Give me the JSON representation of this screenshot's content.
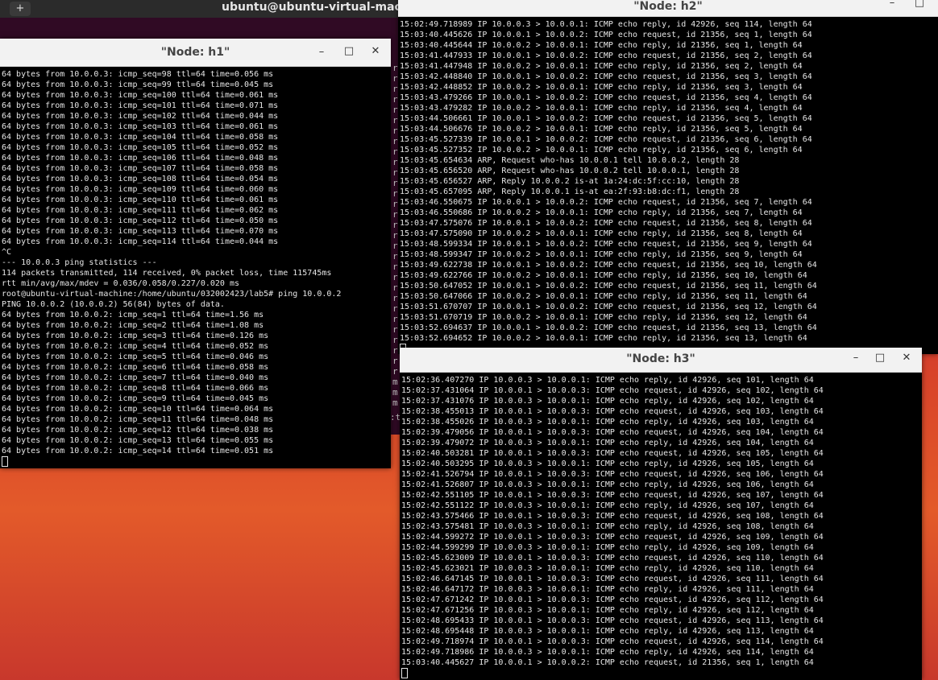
{
  "background_terminal": {
    "title": "ubuntu@ubuntu-virtual-machine",
    "new_tab_icon": "+",
    "side_chars": [
      "r",
      "r",
      "r",
      "r",
      "r",
      "r",
      "r",
      "r",
      "r",
      "r",
      "r",
      "r",
      "r",
      "r",
      "r",
      "r",
      "r",
      "r",
      "r",
      "r",
      "r",
      "r",
      "r",
      "r",
      "r",
      "r",
      "r",
      "r",
      "r",
      "r",
      "m",
      "m",
      "m"
    ],
    "colon": ":t"
  },
  "windows": {
    "h1": {
      "title": "\"Node: h1\"",
      "controls": {
        "minimize": "–",
        "maximize": "□",
        "close": "✕"
      },
      "lines": [
        "64 bytes from 10.0.0.3: icmp_seq=98 ttl=64 time=0.056 ms",
        "64 bytes from 10.0.0.3: icmp_seq=99 ttl=64 time=0.045 ms",
        "64 bytes from 10.0.0.3: icmp_seq=100 ttl=64 time=0.061 ms",
        "64 bytes from 10.0.0.3: icmp_seq=101 ttl=64 time=0.071 ms",
        "64 bytes from 10.0.0.3: icmp_seq=102 ttl=64 time=0.044 ms",
        "64 bytes from 10.0.0.3: icmp_seq=103 ttl=64 time=0.061 ms",
        "64 bytes from 10.0.0.3: icmp_seq=104 ttl=64 time=0.058 ms",
        "64 bytes from 10.0.0.3: icmp_seq=105 ttl=64 time=0.052 ms",
        "64 bytes from 10.0.0.3: icmp_seq=106 ttl=64 time=0.048 ms",
        "64 bytes from 10.0.0.3: icmp_seq=107 ttl=64 time=0.058 ms",
        "64 bytes from 10.0.0.3: icmp_seq=108 ttl=64 time=0.054 ms",
        "64 bytes from 10.0.0.3: icmp_seq=109 ttl=64 time=0.060 ms",
        "64 bytes from 10.0.0.3: icmp_seq=110 ttl=64 time=0.061 ms",
        "64 bytes from 10.0.0.3: icmp_seq=111 ttl=64 time=0.062 ms",
        "64 bytes from 10.0.0.3: icmp_seq=112 ttl=64 time=0.050 ms",
        "64 bytes from 10.0.0.3: icmp_seq=113 ttl=64 time=0.070 ms",
        "64 bytes from 10.0.0.3: icmp_seq=114 ttl=64 time=0.044 ms",
        "^C",
        "--- 10.0.0.3 ping statistics ---",
        "114 packets transmitted, 114 received, 0% packet loss, time 115745ms",
        "rtt min/avg/max/mdev = 0.036/0.058/0.227/0.020 ms",
        "root@ubuntu-virtual-machine:/home/ubuntu/032002423/lab5# ping 10.0.0.2",
        "PING 10.0.0.2 (10.0.0.2) 56(84) bytes of data.",
        "64 bytes from 10.0.0.2: icmp_seq=1 ttl=64 time=1.56 ms",
        "64 bytes from 10.0.0.2: icmp_seq=2 ttl=64 time=1.08 ms",
        "64 bytes from 10.0.0.2: icmp_seq=3 ttl=64 time=0.126 ms",
        "64 bytes from 10.0.0.2: icmp_seq=4 ttl=64 time=0.052 ms",
        "64 bytes from 10.0.0.2: icmp_seq=5 ttl=64 time=0.046 ms",
        "64 bytes from 10.0.0.2: icmp_seq=6 ttl=64 time=0.058 ms",
        "64 bytes from 10.0.0.2: icmp_seq=7 ttl=64 time=0.040 ms",
        "64 bytes from 10.0.0.2: icmp_seq=8 ttl=64 time=0.066 ms",
        "64 bytes from 10.0.0.2: icmp_seq=9 ttl=64 time=0.045 ms",
        "64 bytes from 10.0.0.2: icmp_seq=10 ttl=64 time=0.064 ms",
        "64 bytes from 10.0.0.2: icmp_seq=11 ttl=64 time=0.048 ms",
        "64 bytes from 10.0.0.2: icmp_seq=12 ttl=64 time=0.038 ms",
        "64 bytes from 10.0.0.2: icmp_seq=13 ttl=64 time=0.055 ms",
        "64 bytes from 10.0.0.2: icmp_seq=14 ttl=64 time=0.051 ms"
      ]
    },
    "h2": {
      "title": "\"Node: h2\"",
      "controls": {
        "minimize": "–",
        "maximize": "□"
      },
      "lines": [
        "15:02:49.718989 IP 10.0.0.3 > 10.0.0.1: ICMP echo reply, id 42926, seq 114, length 64",
        "15:03:40.445626 IP 10.0.0.1 > 10.0.0.2: ICMP echo request, id 21356, seq 1, length 64",
        "15:03:40.445644 IP 10.0.0.2 > 10.0.0.1: ICMP echo reply, id 21356, seq 1, length 64",
        "15:03:41.447933 IP 10.0.0.1 > 10.0.0.2: ICMP echo request, id 21356, seq 2, length 64",
        "15:03:41.447948 IP 10.0.0.2 > 10.0.0.1: ICMP echo reply, id 21356, seq 2, length 64",
        "15:03:42.448840 IP 10.0.0.1 > 10.0.0.2: ICMP echo request, id 21356, seq 3, length 64",
        "15:03:42.448852 IP 10.0.0.2 > 10.0.0.1: ICMP echo reply, id 21356, seq 3, length 64",
        "15:03:43.479266 IP 10.0.0.1 > 10.0.0.2: ICMP echo request, id 21356, seq 4, length 64",
        "15:03:43.479282 IP 10.0.0.2 > 10.0.0.1: ICMP echo reply, id 21356, seq 4, length 64",
        "15:03:44.506661 IP 10.0.0.1 > 10.0.0.2: ICMP echo request, id 21356, seq 5, length 64",
        "15:03:44.506676 IP 10.0.0.2 > 10.0.0.1: ICMP echo reply, id 21356, seq 5, length 64",
        "15:03:45.527339 IP 10.0.0.1 > 10.0.0.2: ICMP echo request, id 21356, seq 6, length 64",
        "15:03:45.527352 IP 10.0.0.2 > 10.0.0.1: ICMP echo reply, id 21356, seq 6, length 64",
        "15:03:45.654634 ARP, Request who-has 10.0.0.1 tell 10.0.0.2, length 28",
        "15:03:45.656520 ARP, Request who-has 10.0.0.2 tell 10.0.0.1, length 28",
        "15:03:45.656527 ARP, Reply 10.0.0.2 is-at 1a:24:dc:5f:cc:10, length 28",
        "15:03:45.657095 ARP, Reply 10.0.0.1 is-at ea:2f:93:b8:dc:f1, length 28",
        "15:03:46.550675 IP 10.0.0.1 > 10.0.0.2: ICMP echo request, id 21356, seq 7, length 64",
        "15:03:46.550686 IP 10.0.0.2 > 10.0.0.1: ICMP echo reply, id 21356, seq 7, length 64",
        "15:03:47.575076 IP 10.0.0.1 > 10.0.0.2: ICMP echo request, id 21356, seq 8, length 64",
        "15:03:47.575090 IP 10.0.0.2 > 10.0.0.1: ICMP echo reply, id 21356, seq 8, length 64",
        "15:03:48.599334 IP 10.0.0.1 > 10.0.0.2: ICMP echo request, id 21356, seq 9, length 64",
        "15:03:48.599347 IP 10.0.0.2 > 10.0.0.1: ICMP echo reply, id 21356, seq 9, length 64",
        "15:03:49.622738 IP 10.0.0.1 > 10.0.0.2: ICMP echo request, id 21356, seq 10, length 64",
        "15:03:49.622766 IP 10.0.0.2 > 10.0.0.1: ICMP echo reply, id 21356, seq 10, length 64",
        "15:03:50.647052 IP 10.0.0.1 > 10.0.0.2: ICMP echo request, id 21356, seq 11, length 64",
        "15:03:50.647066 IP 10.0.0.2 > 10.0.0.1: ICMP echo reply, id 21356, seq 11, length 64",
        "15:03:51.670707 IP 10.0.0.1 > 10.0.0.2: ICMP echo request, id 21356, seq 12, length 64",
        "15:03:51.670719 IP 10.0.0.2 > 10.0.0.1: ICMP echo reply, id 21356, seq 12, length 64",
        "15:03:52.694637 IP 10.0.0.1 > 10.0.0.2: ICMP echo request, id 21356, seq 13, length 64",
        "15:03:52.694652 IP 10.0.0.2 > 10.0.0.1: ICMP echo reply, id 21356, seq 13, length 64"
      ]
    },
    "h3": {
      "title": "\"Node: h3\"",
      "controls": {
        "minimize": "–",
        "maximize": "□",
        "close": "✕"
      },
      "lines": [
        "15:02:36.407270 IP 10.0.0.3 > 10.0.0.1: ICMP echo reply, id 42926, seq 101, length 64",
        "15:02:37.431064 IP 10.0.0.1 > 10.0.0.3: ICMP echo request, id 42926, seq 102, length 64",
        "15:02:37.431076 IP 10.0.0.3 > 10.0.0.1: ICMP echo reply, id 42926, seq 102, length 64",
        "15:02:38.455013 IP 10.0.0.1 > 10.0.0.3: ICMP echo request, id 42926, seq 103, length 64",
        "15:02:38.455026 IP 10.0.0.3 > 10.0.0.1: ICMP echo reply, id 42926, seq 103, length 64",
        "15:02:39.479056 IP 10.0.0.1 > 10.0.0.3: ICMP echo request, id 42926, seq 104, length 64",
        "15:02:39.479072 IP 10.0.0.3 > 10.0.0.1: ICMP echo reply, id 42926, seq 104, length 64",
        "15:02:40.503281 IP 10.0.0.1 > 10.0.0.3: ICMP echo request, id 42926, seq 105, length 64",
        "15:02:40.503295 IP 10.0.0.3 > 10.0.0.1: ICMP echo reply, id 42926, seq 105, length 64",
        "15:02:41.526794 IP 10.0.0.1 > 10.0.0.3: ICMP echo request, id 42926, seq 106, length 64",
        "15:02:41.526807 IP 10.0.0.3 > 10.0.0.1: ICMP echo reply, id 42926, seq 106, length 64",
        "15:02:42.551105 IP 10.0.0.1 > 10.0.0.3: ICMP echo request, id 42926, seq 107, length 64",
        "15:02:42.551122 IP 10.0.0.3 > 10.0.0.1: ICMP echo reply, id 42926, seq 107, length 64",
        "15:02:43.575466 IP 10.0.0.1 > 10.0.0.3: ICMP echo request, id 42926, seq 108, length 64",
        "15:02:43.575481 IP 10.0.0.3 > 10.0.0.1: ICMP echo reply, id 42926, seq 108, length 64",
        "15:02:44.599272 IP 10.0.0.1 > 10.0.0.3: ICMP echo request, id 42926, seq 109, length 64",
        "15:02:44.599299 IP 10.0.0.3 > 10.0.0.1: ICMP echo reply, id 42926, seq 109, length 64",
        "15:02:45.623009 IP 10.0.0.1 > 10.0.0.3: ICMP echo request, id 42926, seq 110, length 64",
        "15:02:45.623021 IP 10.0.0.3 > 10.0.0.1: ICMP echo reply, id 42926, seq 110, length 64",
        "15:02:46.647145 IP 10.0.0.1 > 10.0.0.3: ICMP echo request, id 42926, seq 111, length 64",
        "15:02:46.647172 IP 10.0.0.3 > 10.0.0.1: ICMP echo reply, id 42926, seq 111, length 64",
        "15:02:47.671242 IP 10.0.0.1 > 10.0.0.3: ICMP echo request, id 42926, seq 112, length 64",
        "15:02:47.671256 IP 10.0.0.3 > 10.0.0.1: ICMP echo reply, id 42926, seq 112, length 64",
        "15:02:48.695433 IP 10.0.0.1 > 10.0.0.3: ICMP echo request, id 42926, seq 113, length 64",
        "15:02:48.695448 IP 10.0.0.3 > 10.0.0.1: ICMP echo reply, id 42926, seq 113, length 64",
        "15:02:49.718974 IP 10.0.0.1 > 10.0.0.3: ICMP echo request, id 42926, seq 114, length 64",
        "15:02:49.718986 IP 10.0.0.3 > 10.0.0.1: ICMP echo reply, id 42926, seq 114, length 64",
        "15:03:40.445627 IP 10.0.0.1 > 10.0.0.2: ICMP echo request, id 21356, seq 1, length 64"
      ]
    }
  }
}
